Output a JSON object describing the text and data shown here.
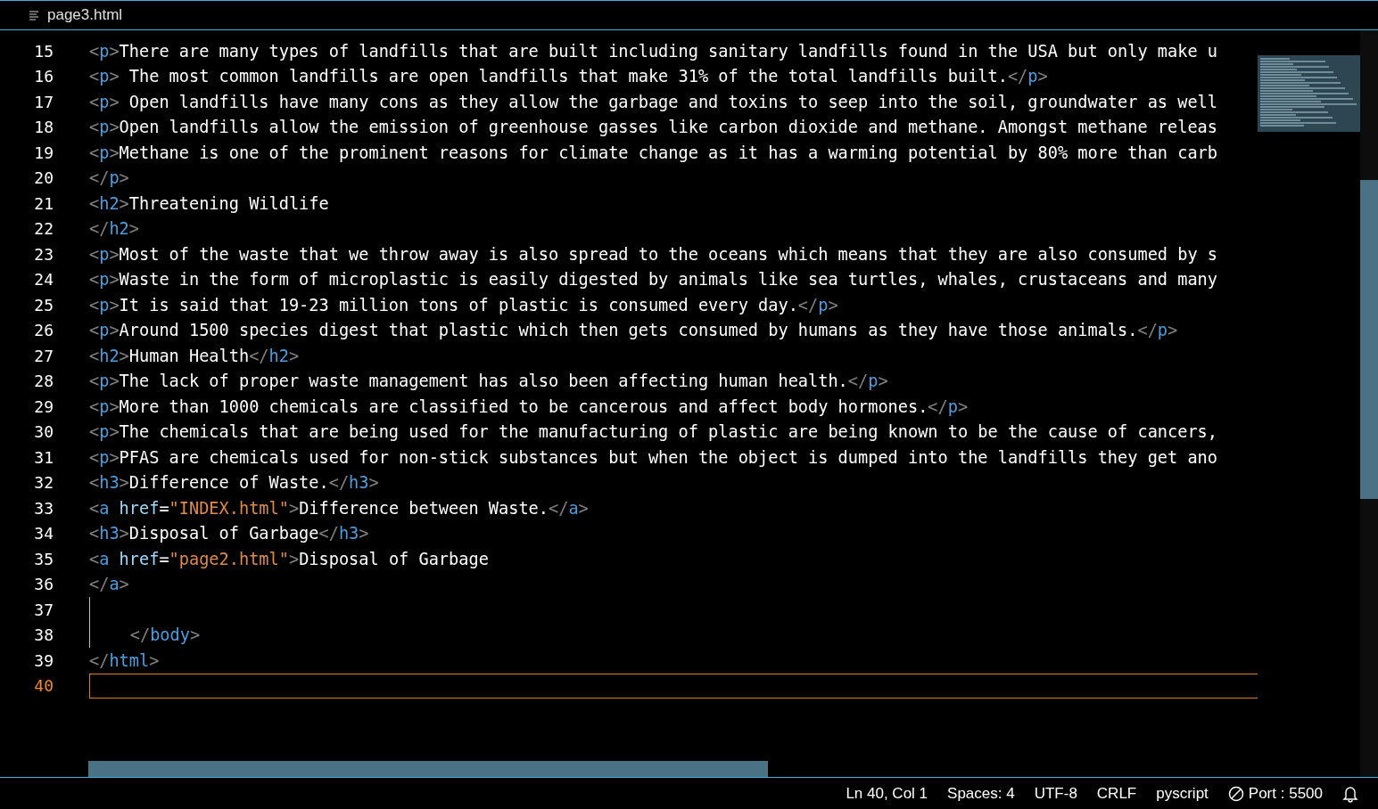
{
  "tab": {
    "title": "page3.html"
  },
  "editor": {
    "lines": [
      {
        "number": "15",
        "current": false,
        "indent_guide": false,
        "segments": [
          {
            "kind": "bracket",
            "text": "<"
          },
          {
            "kind": "tag",
            "text": "p"
          },
          {
            "kind": "bracket",
            "text": ">"
          },
          {
            "kind": "text",
            "text": "There are many types of landfills that are built including sanitary landfills found in the USA but only make u"
          }
        ]
      },
      {
        "number": "16",
        "current": false,
        "indent_guide": false,
        "segments": [
          {
            "kind": "bracket",
            "text": "<"
          },
          {
            "kind": "tag",
            "text": "p"
          },
          {
            "kind": "bracket",
            "text": ">"
          },
          {
            "kind": "text",
            "text": " The most common landfills are open landfills that make 31% of the total landfills built."
          },
          {
            "kind": "bracket",
            "text": "</"
          },
          {
            "kind": "tag",
            "text": "p"
          },
          {
            "kind": "bracket",
            "text": ">"
          }
        ]
      },
      {
        "number": "17",
        "current": false,
        "indent_guide": false,
        "segments": [
          {
            "kind": "bracket",
            "text": "<"
          },
          {
            "kind": "tag",
            "text": "p"
          },
          {
            "kind": "bracket",
            "text": ">"
          },
          {
            "kind": "text",
            "text": " Open landfills have many cons as they allow the garbage and toxins to seep into the soil, groundwater as well"
          }
        ]
      },
      {
        "number": "18",
        "current": false,
        "indent_guide": false,
        "segments": [
          {
            "kind": "bracket",
            "text": "<"
          },
          {
            "kind": "tag",
            "text": "p"
          },
          {
            "kind": "bracket",
            "text": ">"
          },
          {
            "kind": "text",
            "text": "Open landfills allow the emission of greenhouse gasses like carbon dioxide and methane. Amongst methane releas"
          }
        ]
      },
      {
        "number": "19",
        "current": false,
        "indent_guide": false,
        "segments": [
          {
            "kind": "bracket",
            "text": "<"
          },
          {
            "kind": "tag",
            "text": "p"
          },
          {
            "kind": "bracket",
            "text": ">"
          },
          {
            "kind": "text",
            "text": "Methane is one of the prominent reasons for climate change as it has a warming potential by 80% more than carb"
          }
        ]
      },
      {
        "number": "20",
        "current": false,
        "indent_guide": false,
        "segments": [
          {
            "kind": "bracket",
            "text": "</"
          },
          {
            "kind": "tag",
            "text": "p"
          },
          {
            "kind": "bracket",
            "text": ">"
          }
        ]
      },
      {
        "number": "21",
        "current": false,
        "indent_guide": false,
        "segments": [
          {
            "kind": "bracket",
            "text": "<"
          },
          {
            "kind": "tag",
            "text": "h2"
          },
          {
            "kind": "bracket",
            "text": ">"
          },
          {
            "kind": "text",
            "text": "Threatening Wildlife"
          }
        ]
      },
      {
        "number": "22",
        "current": false,
        "indent_guide": false,
        "segments": [
          {
            "kind": "bracket",
            "text": "</"
          },
          {
            "kind": "tag",
            "text": "h2"
          },
          {
            "kind": "bracket",
            "text": ">"
          }
        ]
      },
      {
        "number": "23",
        "current": false,
        "indent_guide": false,
        "segments": [
          {
            "kind": "bracket",
            "text": "<"
          },
          {
            "kind": "tag",
            "text": "p"
          },
          {
            "kind": "bracket",
            "text": ">"
          },
          {
            "kind": "text",
            "text": "Most of the waste that we throw away is also spread to the oceans which means that they are also consumed by s"
          }
        ]
      },
      {
        "number": "24",
        "current": false,
        "indent_guide": false,
        "segments": [
          {
            "kind": "bracket",
            "text": "<"
          },
          {
            "kind": "tag",
            "text": "p"
          },
          {
            "kind": "bracket",
            "text": ">"
          },
          {
            "kind": "text",
            "text": "Waste in the form of microplastic is easily digested by animals like sea turtles, whales, crustaceans and many"
          }
        ]
      },
      {
        "number": "25",
        "current": false,
        "indent_guide": false,
        "segments": [
          {
            "kind": "bracket",
            "text": "<"
          },
          {
            "kind": "tag",
            "text": "p"
          },
          {
            "kind": "bracket",
            "text": ">"
          },
          {
            "kind": "text",
            "text": "It is said that 19-23 million tons of plastic is consumed every day."
          },
          {
            "kind": "bracket",
            "text": "</"
          },
          {
            "kind": "tag",
            "text": "p"
          },
          {
            "kind": "bracket",
            "text": ">"
          }
        ]
      },
      {
        "number": "26",
        "current": false,
        "indent_guide": false,
        "segments": [
          {
            "kind": "bracket",
            "text": "<"
          },
          {
            "kind": "tag",
            "text": "p"
          },
          {
            "kind": "bracket",
            "text": ">"
          },
          {
            "kind": "text",
            "text": "Around 1500 species digest that plastic which then gets consumed by humans as they have those animals."
          },
          {
            "kind": "bracket",
            "text": "</"
          },
          {
            "kind": "tag",
            "text": "p"
          },
          {
            "kind": "bracket",
            "text": ">"
          }
        ]
      },
      {
        "number": "27",
        "current": false,
        "indent_guide": false,
        "segments": [
          {
            "kind": "bracket",
            "text": "<"
          },
          {
            "kind": "tag",
            "text": "h2"
          },
          {
            "kind": "bracket",
            "text": ">"
          },
          {
            "kind": "text",
            "text": "Human Health"
          },
          {
            "kind": "bracket",
            "text": "</"
          },
          {
            "kind": "tag",
            "text": "h2"
          },
          {
            "kind": "bracket",
            "text": ">"
          }
        ]
      },
      {
        "number": "28",
        "current": false,
        "indent_guide": false,
        "segments": [
          {
            "kind": "bracket",
            "text": "<"
          },
          {
            "kind": "tag",
            "text": "p"
          },
          {
            "kind": "bracket",
            "text": ">"
          },
          {
            "kind": "text",
            "text": "The lack of proper waste management has also been affecting human health."
          },
          {
            "kind": "bracket",
            "text": "</"
          },
          {
            "kind": "tag",
            "text": "p"
          },
          {
            "kind": "bracket",
            "text": ">"
          }
        ]
      },
      {
        "number": "29",
        "current": false,
        "indent_guide": false,
        "segments": [
          {
            "kind": "bracket",
            "text": "<"
          },
          {
            "kind": "tag",
            "text": "p"
          },
          {
            "kind": "bracket",
            "text": ">"
          },
          {
            "kind": "text",
            "text": "More than 1000 chemicals are classified to be cancerous and affect body hormones."
          },
          {
            "kind": "bracket",
            "text": "</"
          },
          {
            "kind": "tag",
            "text": "p"
          },
          {
            "kind": "bracket",
            "text": ">"
          }
        ]
      },
      {
        "number": "30",
        "current": false,
        "indent_guide": false,
        "segments": [
          {
            "kind": "bracket",
            "text": "<"
          },
          {
            "kind": "tag",
            "text": "p"
          },
          {
            "kind": "bracket",
            "text": ">"
          },
          {
            "kind": "text",
            "text": "The chemicals that are being used for the manufacturing of plastic are being known to be the cause of cancers,"
          }
        ]
      },
      {
        "number": "31",
        "current": false,
        "indent_guide": false,
        "segments": [
          {
            "kind": "bracket",
            "text": "<"
          },
          {
            "kind": "tag",
            "text": "p"
          },
          {
            "kind": "bracket",
            "text": ">"
          },
          {
            "kind": "text",
            "text": "PFAS are chemicals used for non-stick substances but when the object is dumped into the landfills they get ano"
          }
        ]
      },
      {
        "number": "32",
        "current": false,
        "indent_guide": false,
        "segments": [
          {
            "kind": "bracket",
            "text": "<"
          },
          {
            "kind": "tag",
            "text": "h3"
          },
          {
            "kind": "bracket",
            "text": ">"
          },
          {
            "kind": "text",
            "text": "Difference of Waste."
          },
          {
            "kind": "bracket",
            "text": "</"
          },
          {
            "kind": "tag",
            "text": "h3"
          },
          {
            "kind": "bracket",
            "text": ">"
          }
        ]
      },
      {
        "number": "33",
        "current": false,
        "indent_guide": false,
        "segments": [
          {
            "kind": "bracket",
            "text": "<"
          },
          {
            "kind": "tag",
            "text": "a"
          },
          {
            "kind": "attr",
            "text": " href"
          },
          {
            "kind": "text",
            "text": "="
          },
          {
            "kind": "string",
            "text": "\"INDEX.html\""
          },
          {
            "kind": "bracket",
            "text": ">"
          },
          {
            "kind": "text",
            "text": "Difference between Waste."
          },
          {
            "kind": "bracket",
            "text": "</"
          },
          {
            "kind": "tag",
            "text": "a"
          },
          {
            "kind": "bracket",
            "text": ">"
          }
        ]
      },
      {
        "number": "34",
        "current": false,
        "indent_guide": false,
        "segments": [
          {
            "kind": "bracket",
            "text": "<"
          },
          {
            "kind": "tag",
            "text": "h3"
          },
          {
            "kind": "bracket",
            "text": ">"
          },
          {
            "kind": "text",
            "text": "Disposal of Garbage"
          },
          {
            "kind": "bracket",
            "text": "</"
          },
          {
            "kind": "tag",
            "text": "h3"
          },
          {
            "kind": "bracket",
            "text": ">"
          }
        ]
      },
      {
        "number": "35",
        "current": false,
        "indent_guide": false,
        "segments": [
          {
            "kind": "bracket",
            "text": "<"
          },
          {
            "kind": "tag",
            "text": "a"
          },
          {
            "kind": "attr",
            "text": " href"
          },
          {
            "kind": "text",
            "text": "="
          },
          {
            "kind": "string",
            "text": "\"page2.html\""
          },
          {
            "kind": "bracket",
            "text": ">"
          },
          {
            "kind": "text",
            "text": "Disposal of Garbage"
          }
        ]
      },
      {
        "number": "36",
        "current": false,
        "indent_guide": false,
        "segments": [
          {
            "kind": "bracket",
            "text": "</"
          },
          {
            "kind": "tag",
            "text": "a"
          },
          {
            "kind": "bracket",
            "text": ">"
          }
        ]
      },
      {
        "number": "37",
        "current": false,
        "indent_guide": true
      },
      {
        "number": "38",
        "current": false,
        "indent_guide": true,
        "indented": true,
        "segments": [
          {
            "kind": "bracket",
            "text": "</"
          },
          {
            "kind": "tag",
            "text": "body"
          },
          {
            "kind": "bracket",
            "text": ">"
          }
        ]
      },
      {
        "number": "39",
        "current": false,
        "indent_guide": false,
        "segments": [
          {
            "kind": "bracket",
            "text": "</"
          },
          {
            "kind": "tag",
            "text": "html"
          },
          {
            "kind": "bracket",
            "text": ">"
          }
        ]
      },
      {
        "number": "40",
        "current": true,
        "indent_guide": false
      }
    ]
  },
  "status_bar": {
    "items": [
      {
        "kind": "text",
        "text": "Ln 40, Col 1"
      },
      {
        "kind": "text",
        "text": "Spaces: 4"
      },
      {
        "kind": "text",
        "text": "UTF-8"
      },
      {
        "kind": "text",
        "text": "CRLF"
      },
      {
        "kind": "text",
        "text": "pyscript"
      },
      {
        "kind": "port",
        "text": "Port : 5500"
      },
      {
        "kind": "bell"
      }
    ]
  }
}
